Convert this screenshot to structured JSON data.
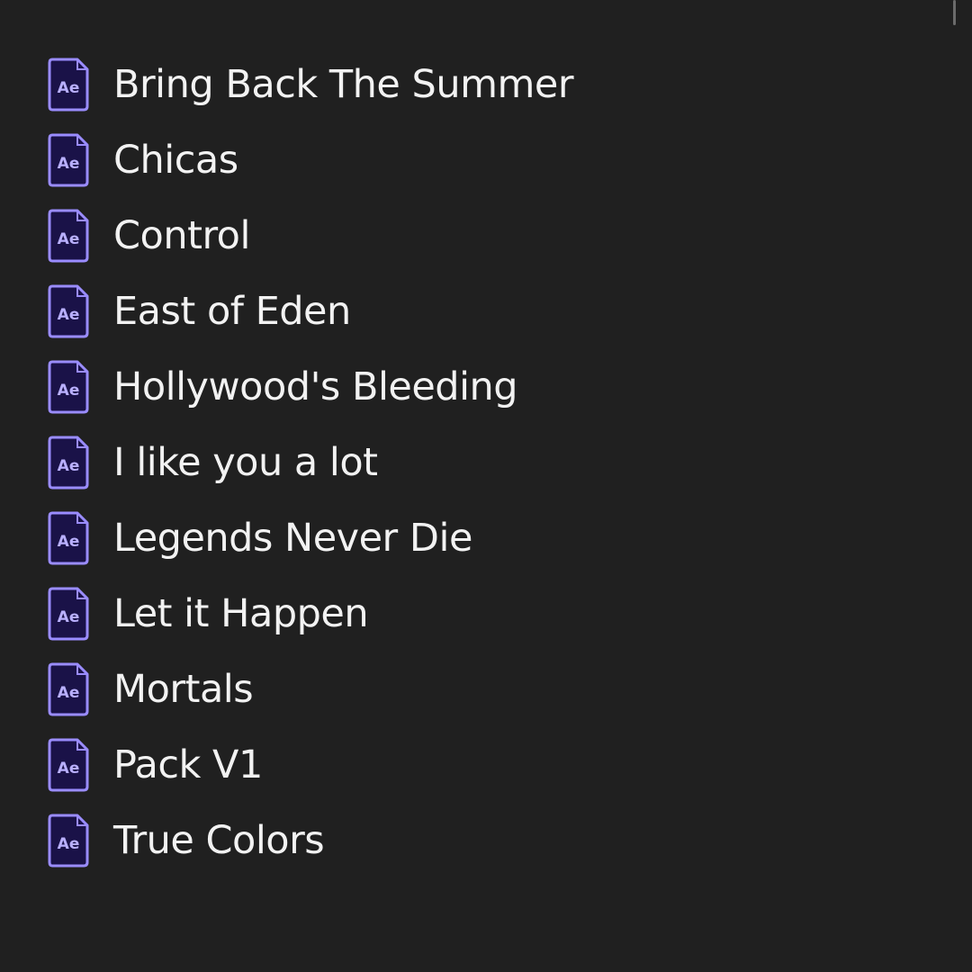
{
  "icon": {
    "name": "after-effects-project-icon",
    "text": "Ae",
    "border_color": "#9a8cff",
    "fill_color": "#1a1248",
    "text_color": "#b9b0ff"
  },
  "files": [
    {
      "label": "Bring Back The Summer"
    },
    {
      "label": "Chicas"
    },
    {
      "label": "Control"
    },
    {
      "label": "East of Eden"
    },
    {
      "label": "Hollywood's Bleeding"
    },
    {
      "label": "I like you a lot"
    },
    {
      "label": "Legends Never Die"
    },
    {
      "label": "Let it Happen"
    },
    {
      "label": "Mortals"
    },
    {
      "label": "Pack V1"
    },
    {
      "label": "True Colors"
    }
  ]
}
